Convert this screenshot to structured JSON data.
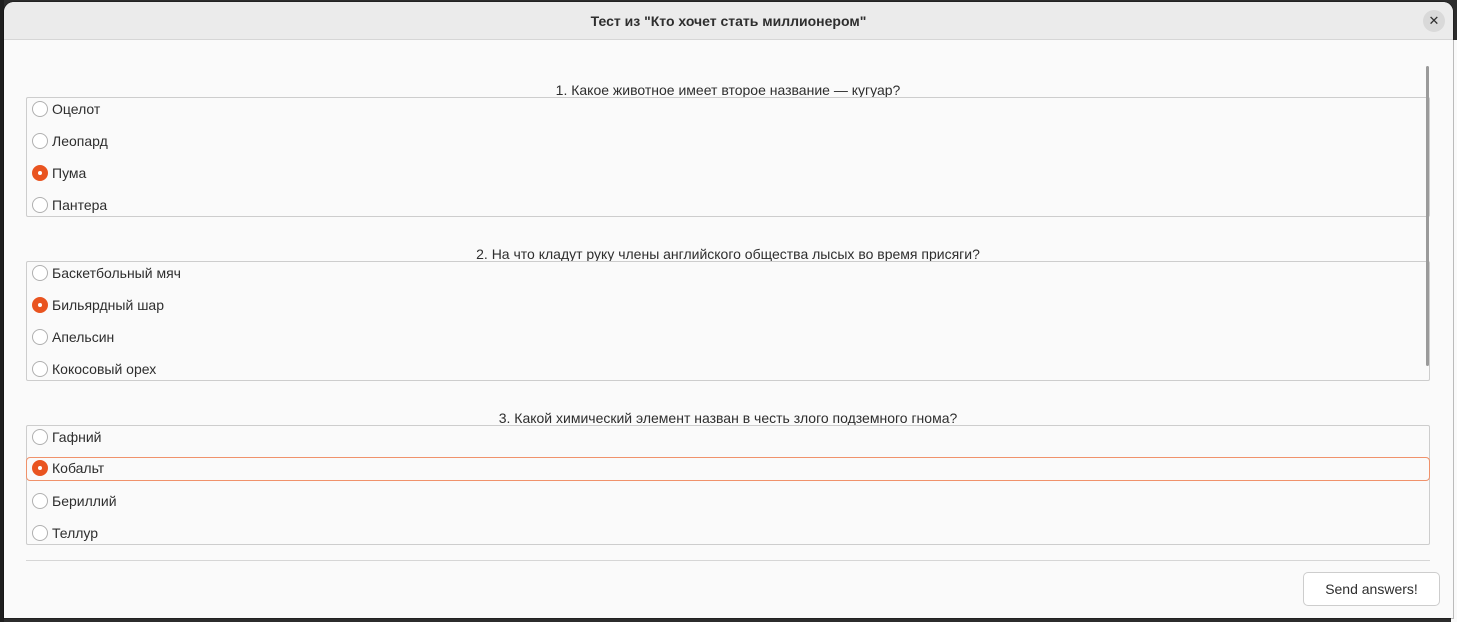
{
  "window": {
    "title": "Тест из \"Кто хочет стать миллионером\"",
    "close_icon": "close-icon",
    "close_glyph": "✕"
  },
  "questions": [
    {
      "title": "1. Какое животное имеет второе название — кугуар?",
      "options": [
        {
          "label": "Оцелот",
          "checked": false
        },
        {
          "label": "Леопард",
          "checked": false
        },
        {
          "label": "Пума",
          "checked": true
        },
        {
          "label": "Пантера",
          "checked": false
        }
      ]
    },
    {
      "title": "2. На что кладут руку члены английского общества лысых во время присяги?",
      "options": [
        {
          "label": "Баскетбольный мяч",
          "checked": false
        },
        {
          "label": "Бильярдный шар",
          "checked": true
        },
        {
          "label": "Апельсин",
          "checked": false
        },
        {
          "label": "Кокосовый орех",
          "checked": false
        }
      ]
    },
    {
      "title": "3. Какой химический элемент назван в честь злого подземного гнома?",
      "options": [
        {
          "label": "Гафний",
          "checked": false
        },
        {
          "label": "Кобальт",
          "checked": true,
          "focused": true
        },
        {
          "label": "Бериллий",
          "checked": false
        },
        {
          "label": "Теллур",
          "checked": false
        }
      ]
    }
  ],
  "footer": {
    "send_label": "Send answers!"
  },
  "colors": {
    "accent": "#e95420",
    "focus_ring": "#f0926b",
    "window_bg": "#fafafa",
    "titlebar_bg": "#ebebeb"
  }
}
